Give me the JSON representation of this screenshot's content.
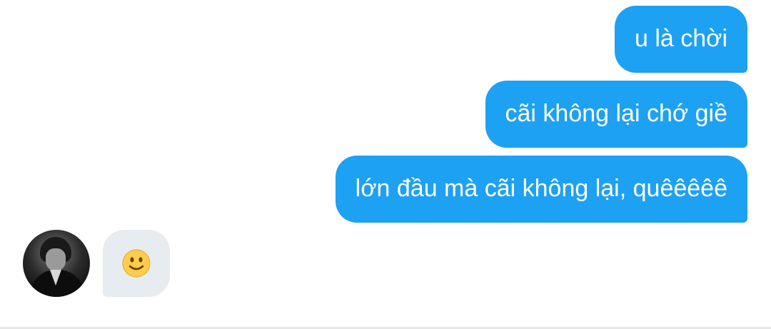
{
  "thread": {
    "outgoing_messages": [
      {
        "text": "u là chời"
      },
      {
        "text": "cãi không lại chớ giề"
      },
      {
        "text": "lớn đầu mà cãi không lại, quêêêêê"
      }
    ],
    "incoming_message": {
      "emoji": "slightly-smiling-face"
    }
  },
  "colors": {
    "outgoing_bubble": "#1da1f2",
    "incoming_bubble": "#e6ecf0",
    "outgoing_text": "#ffffff",
    "emoji_face": "#ffcc4d"
  }
}
